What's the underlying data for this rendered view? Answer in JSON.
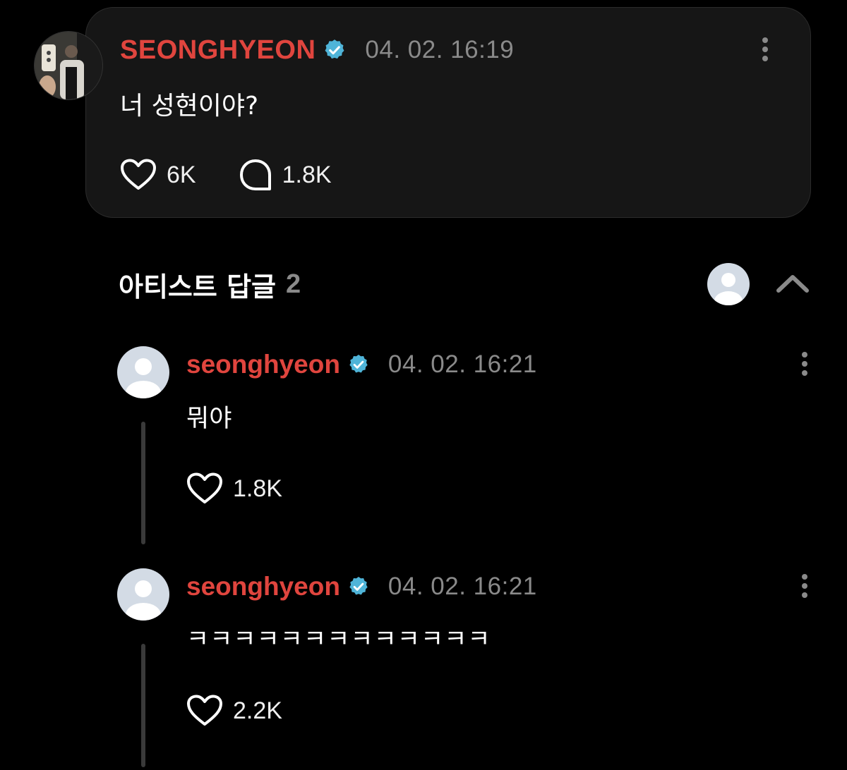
{
  "colors": {
    "background": "#000000",
    "card": "#161616",
    "author_name": "#e0453e",
    "verified": "#4fb4d8",
    "muted": "#8a8a8a"
  },
  "post": {
    "author": "SEONGHYEON",
    "timestamp": "04. 02. 16:19",
    "text": "너 성현이야?",
    "likes": "6K",
    "comments": "1.8K",
    "icons": [
      "heart-icon",
      "comment-icon",
      "more-vertical-icon",
      "verified-badge-icon"
    ]
  },
  "section": {
    "title": "아티스트 답글",
    "count": "2",
    "icons": [
      "avatar-placeholder-icon",
      "chevron-up-icon"
    ]
  },
  "replies": [
    {
      "author": "seonghyeon",
      "timestamp": "04. 02. 16:21",
      "text": "뭐야",
      "likes": "1.8K"
    },
    {
      "author": "seonghyeon",
      "timestamp": "04. 02. 16:21",
      "text": "ㅋㅋㅋㅋㅋㅋㅋㅋㅋㅋㅋㅋㅋ",
      "likes": "2.2K"
    }
  ]
}
